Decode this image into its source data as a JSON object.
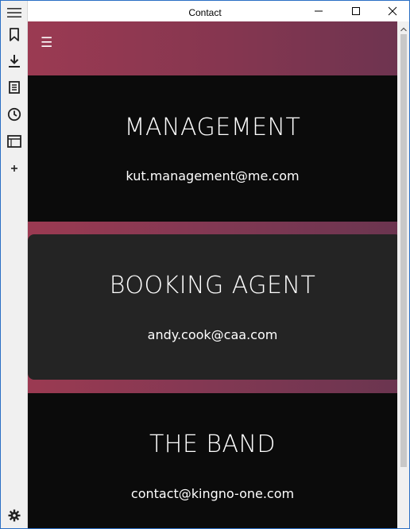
{
  "window": {
    "title": "Contact",
    "minimize_icon": "minimize-icon",
    "maximize_icon": "maximize-icon",
    "close_icon": "close-icon"
  },
  "sidebar": {
    "items": [
      {
        "icon": "hamburger-menu-icon"
      },
      {
        "icon": "bookmark-icon"
      },
      {
        "icon": "download-icon"
      },
      {
        "icon": "reading-list-icon"
      },
      {
        "icon": "history-icon"
      },
      {
        "icon": "window-icon"
      },
      {
        "icon": "plus-icon"
      }
    ],
    "footer_icon": "gear-icon"
  },
  "page": {
    "menu_glyph": "☰",
    "sections": [
      {
        "heading": "MANAGEMENT",
        "email": "kut.management@me.com"
      },
      {
        "heading": "BOOKING AGENT",
        "email": "andy.cook@caa.com"
      },
      {
        "heading": "THE BAND",
        "email": "contact@kingno-one.com"
      }
    ]
  },
  "colors": {
    "accent_gradient_start": "#9b3a52",
    "accent_gradient_end": "#6e3450",
    "section_bg": "#0b0b0b",
    "card_bg": "#242424",
    "text": "#ffffff"
  }
}
